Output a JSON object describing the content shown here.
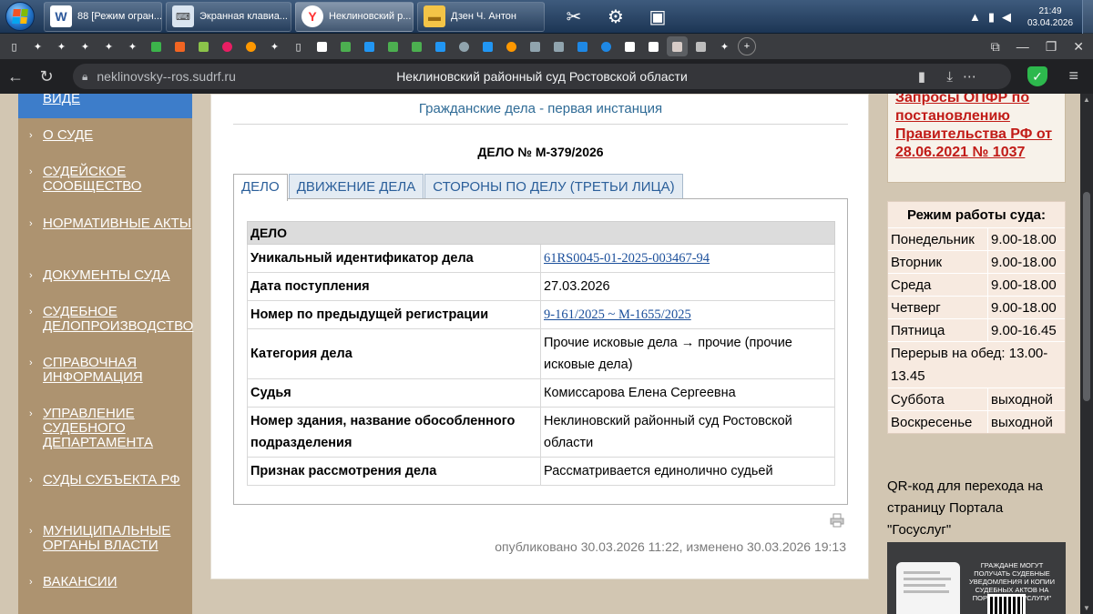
{
  "taskbar": {
    "tasks": [
      {
        "label": "88 [Режим огран...",
        "icon": "word-icon"
      },
      {
        "label": "Экранная клавиа...",
        "icon": "keyboard-icon"
      },
      {
        "label": "Неклиновский р...",
        "icon": "yandex-browser-icon"
      },
      {
        "label": "Дзен Ч. Антон",
        "icon": "folder-icon"
      }
    ],
    "clock_time": "21:49",
    "clock_date": "03.04.2026"
  },
  "browser": {
    "url_domain": "neklinovsky--ros.sudrf.ru",
    "page_title": "Неклиновский районный суд Ростовской области"
  },
  "left_menu": {
    "top_item": "ВИДЕ",
    "items": [
      "О СУДЕ",
      "СУДЕЙСКОЕ СООБЩЕСТВО",
      "НОРМАТИВНЫЕ АКТЫ",
      "ДОКУМЕНТЫ СУДА",
      "СУДЕБНОЕ ДЕЛОПРОИЗВОДСТВО",
      "СПРАВОЧНАЯ ИНФОРМАЦИЯ",
      "УПРАВЛЕНИЕ СУДЕБНОГО ДЕПАРТАМЕНТА",
      "СУДЫ СУБЪЕКТА РФ",
      "МУНИЦИПАЛЬНЫЕ ОРГАНЫ ВЛАСТИ",
      "ВАКАНСИИ"
    ]
  },
  "main": {
    "section_title": "Гражданские дела - первая инстанция",
    "case_title": "ДЕЛО № М-379/2026",
    "tabs": [
      "ДЕЛО",
      "ДВИЖЕНИЕ ДЕЛА",
      "СТОРОНЫ ПО ДЕЛУ (ТРЕТЬИ ЛИЦА)"
    ],
    "table_header": "ДЕЛО",
    "rows": [
      {
        "label": "Уникальный идентификатор дела",
        "value": "61RS0045-01-2025-003467-94",
        "link": true
      },
      {
        "label": "Дата поступления",
        "value": "27.03.2026",
        "link": false
      },
      {
        "label": "Номер по предыдущей регистрации",
        "value": "9-161/2025 ~ М-1655/2025",
        "link": true
      },
      {
        "label": "Категория дела",
        "value": "Прочие исковые дела → прочие (прочие исковые дела)",
        "link": false
      },
      {
        "label": "Судья",
        "value": "Комиссарова Елена Сергеевна",
        "link": false
      },
      {
        "label": "Номер здания, название обособленного подразделения",
        "value": "Неклиновский районный суд Ростовской области",
        "link": false
      },
      {
        "label": "Признак рассмотрения дела",
        "value": "Рассматривается единолично судьей",
        "link": false
      }
    ],
    "published": "опубликовано 30.03.2026 11:22, изменено 30.03.2026 19:13"
  },
  "right": {
    "pfr_link": "Запросы ОПФР по постановлению Правительства РФ от 28.06.2021 № 1037",
    "hours_title": "Режим работы суда:",
    "hours": [
      {
        "day": "Понедельник",
        "time": "9.00-18.00"
      },
      {
        "day": "Вторник",
        "time": "9.00-18.00"
      },
      {
        "day": "Среда",
        "time": "9.00-18.00"
      },
      {
        "day": "Четверг",
        "time": "9.00-18.00"
      },
      {
        "day": "Пятница",
        "time": "9.00-16.45"
      }
    ],
    "break": "Перерыв на обед: 13.00-13.45",
    "weekend": [
      {
        "day": "Суббота",
        "time": "выходной"
      },
      {
        "day": "Воскресенье",
        "time": "выходной"
      }
    ],
    "qr_text": "QR-код для перехода на страницу Портала \"Госуслуг\"",
    "qr_banner_text": "Граждане могут получать судебные уведомления и копии судебных актов на портале \"Госуслуги\""
  },
  "colors": {
    "menu_bg": "#ad9370",
    "menu_active": "#3d7dca",
    "link_blue": "#1b4f9b",
    "pfr_red": "#c11b17"
  }
}
